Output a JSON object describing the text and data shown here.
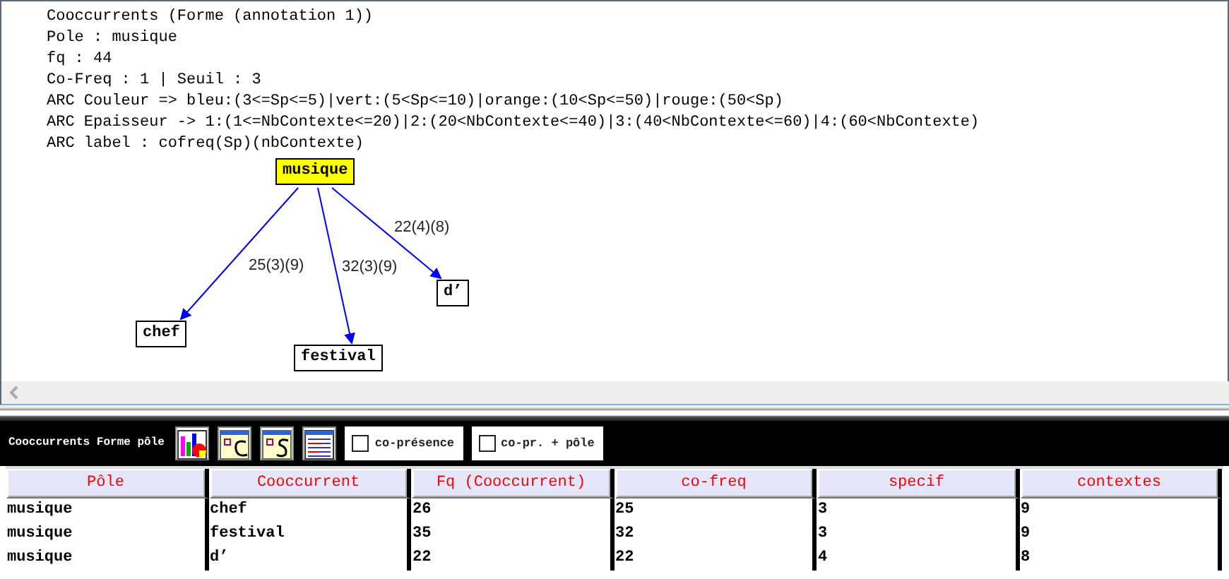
{
  "info_lines": [
    "Cooccurrents (Forme (annotation 1))",
    "Pole : musique",
    "fq : 44",
    "Co-Freq : 1 | Seuil : 3",
    "ARC Couleur => bleu:(3<=Sp<=5)|vert:(5<Sp<=10)|orange:(10<Sp<=50)|rouge:(50<Sp)",
    "ARC Epaisseur -> 1:(1<=NbContexte<=20)|2:(20<NbContexte<=40)|3:(40<NbContexte<=60)|4:(60<NbContexte)",
    "ARC label : cofreq(Sp)(nbContexte)"
  ],
  "graph": {
    "nodes": [
      {
        "label": "musique",
        "kind": "pole"
      },
      {
        "label": "chef",
        "kind": "cooccurrent",
        "edge_label": "25(3)(9)"
      },
      {
        "label": "festival",
        "kind": "cooccurrent",
        "edge_label": "32(3)(9)"
      },
      {
        "label": "d’",
        "kind": "cooccurrent",
        "edge_label": "22(4)(8)"
      }
    ]
  },
  "toolbar": {
    "title": "Cooccurrents Forme pôle",
    "checkboxes": [
      {
        "label": "co-présence",
        "checked": false
      },
      {
        "label": "co-pr. + pôle",
        "checked": false
      }
    ]
  },
  "table": {
    "columns": [
      "Pôle",
      "Cooccurrent",
      "Fq (Cooccurrent)",
      "co-freq",
      "specif",
      "contextes"
    ],
    "rows": [
      [
        "musique",
        "chef",
        "26",
        "25",
        "3",
        "9"
      ],
      [
        "musique",
        "festival",
        "35",
        "32",
        "3",
        "9"
      ],
      [
        "musique",
        "d’",
        "22",
        "22",
        "4",
        "8"
      ]
    ]
  }
}
